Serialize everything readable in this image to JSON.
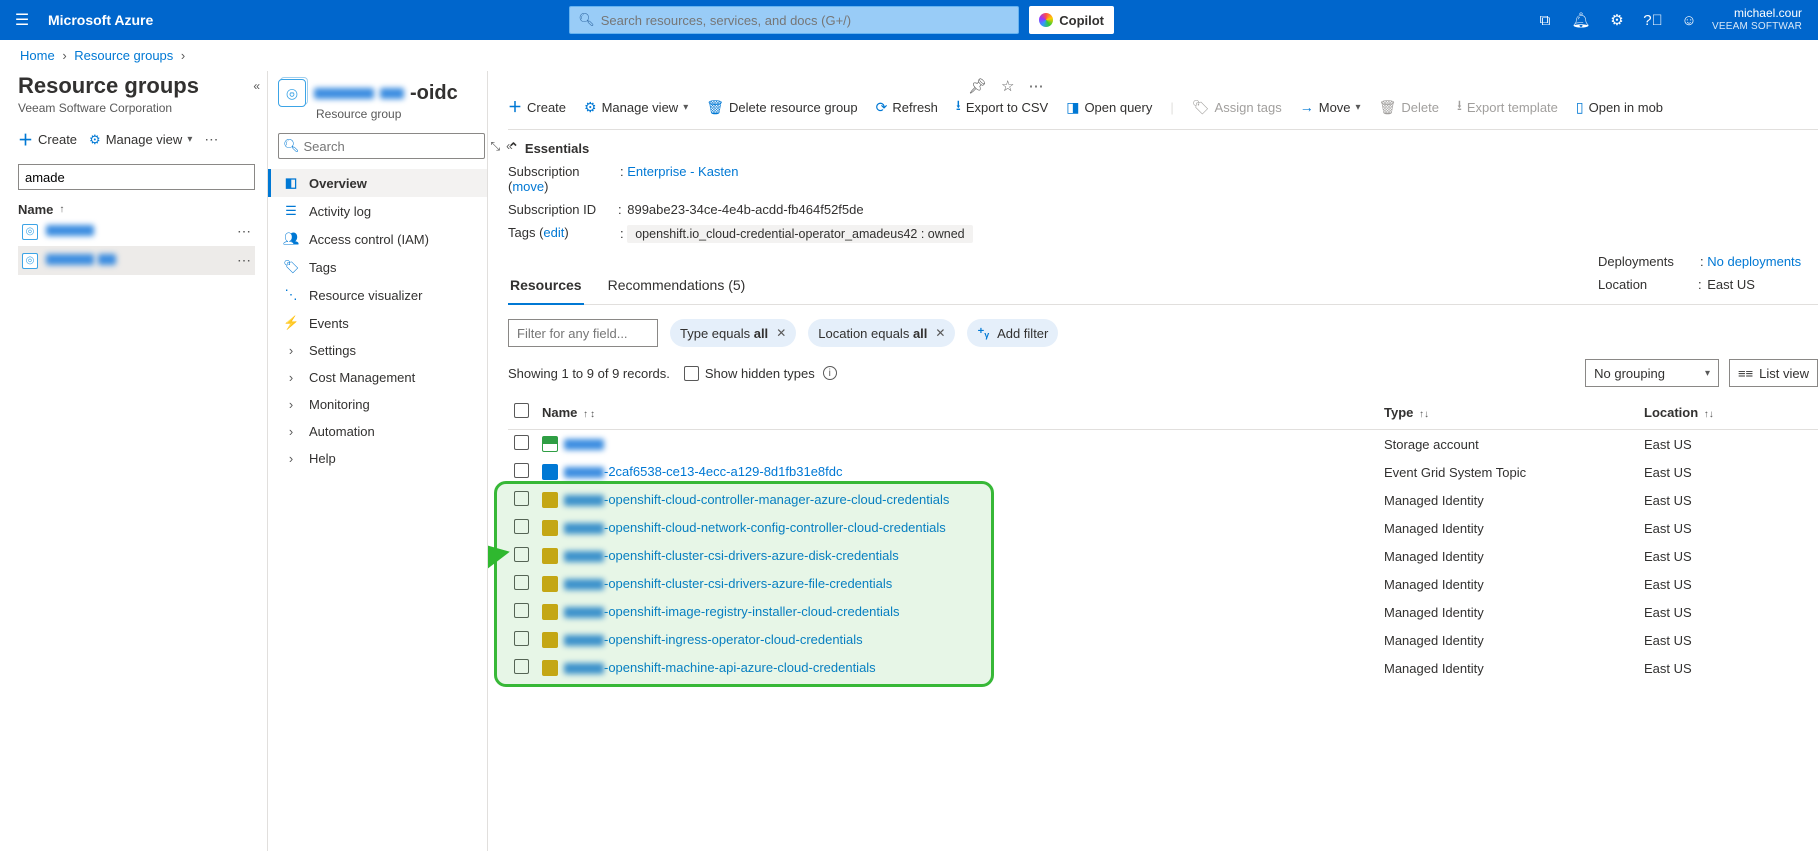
{
  "header": {
    "brand": "Microsoft Azure",
    "search_placeholder": "Search resources, services, and docs (G+/)",
    "copilot": "Copilot",
    "account_name": "michael.cour",
    "account_org": "VEEAM SOFTWAR"
  },
  "breadcrumb": {
    "home": "Home",
    "rg": "Resource groups"
  },
  "col1": {
    "title": "Resource groups",
    "subtitle": "Veeam Software Corporation",
    "create": "Create",
    "manage_view": "Manage view",
    "filter_value": "amade",
    "col_header": "Name",
    "items": [
      {
        "name": "████████"
      },
      {
        "name": "████████   ██"
      }
    ]
  },
  "rg_nav": {
    "title_suffix": "-oidc",
    "subtitle": "Resource group",
    "search_placeholder": "Search",
    "items": [
      {
        "icon": "overview",
        "label": "Overview",
        "active": true
      },
      {
        "icon": "activity",
        "label": "Activity log"
      },
      {
        "icon": "iam",
        "label": "Access control (IAM)"
      },
      {
        "icon": "tags",
        "label": "Tags"
      },
      {
        "icon": "visualizer",
        "label": "Resource visualizer"
      },
      {
        "icon": "events",
        "label": "Events"
      },
      {
        "icon": "chev",
        "label": "Settings"
      },
      {
        "icon": "chev",
        "label": "Cost Management"
      },
      {
        "icon": "chev",
        "label": "Monitoring"
      },
      {
        "icon": "chev",
        "label": "Automation"
      },
      {
        "icon": "chev",
        "label": "Help"
      }
    ]
  },
  "cmdbar": {
    "create": "Create",
    "manage_view": "Manage view",
    "delete_rg": "Delete resource group",
    "refresh": "Refresh",
    "export_csv": "Export to CSV",
    "open_query": "Open query",
    "assign_tags": "Assign tags",
    "move": "Move",
    "delete": "Delete",
    "export_template": "Export template",
    "open_mobile": "Open in mob"
  },
  "essentials": {
    "heading": "Essentials",
    "subscription_label": "Subscription",
    "subscription_move": "move",
    "subscription_value": "Enterprise - Kasten",
    "subscription_id_label": "Subscription ID",
    "subscription_id_value": "899abe23-34ce-4e4b-acdd-fb464f52f5de",
    "tags_label": "Tags",
    "tags_edit": "edit",
    "tag_chip": "openshift.io_cloud-credential-operator_amadeus42 : owned",
    "deployments_label": "Deployments",
    "deployments_value": "No deployments",
    "location_label": "Location",
    "location_value": "East US"
  },
  "tabs": {
    "resources": "Resources",
    "recommendations": "Recommendations (5)"
  },
  "filters": {
    "filter_placeholder": "Filter for any field...",
    "type_pill": "Type equals all",
    "location_pill": "Location equals all",
    "add_filter": "Add filter",
    "records": "Showing 1 to 9 of 9 records.",
    "hidden_types": "Show hidden types",
    "no_grouping": "No grouping",
    "list_view": "List view"
  },
  "table": {
    "col_name": "Name",
    "col_type": "Type",
    "col_location": "Location",
    "rows": [
      {
        "icon": "sa",
        "name_redacted": true,
        "suffix": "",
        "type": "Storage account",
        "location": "East US",
        "hl": false
      },
      {
        "icon": "eg",
        "name_redacted": true,
        "suffix": "-2caf6538-ce13-4ecc-a129-8d1fb31e8fdc",
        "type": "Event Grid System Topic",
        "location": "East US",
        "hl": false
      },
      {
        "icon": "mi",
        "name_redacted": true,
        "suffix": "-openshift-cloud-controller-manager-azure-cloud-credentials",
        "type": "Managed Identity",
        "location": "East US",
        "hl": true
      },
      {
        "icon": "mi",
        "name_redacted": true,
        "suffix": "-openshift-cloud-network-config-controller-cloud-credentials",
        "type": "Managed Identity",
        "location": "East US",
        "hl": true
      },
      {
        "icon": "mi",
        "name_redacted": true,
        "suffix": "-openshift-cluster-csi-drivers-azure-disk-credentials",
        "type": "Managed Identity",
        "location": "East US",
        "hl": true
      },
      {
        "icon": "mi",
        "name_redacted": true,
        "suffix": "-openshift-cluster-csi-drivers-azure-file-credentials",
        "type": "Managed Identity",
        "location": "East US",
        "hl": true
      },
      {
        "icon": "mi",
        "name_redacted": true,
        "suffix": "-openshift-image-registry-installer-cloud-credentials",
        "type": "Managed Identity",
        "location": "East US",
        "hl": true
      },
      {
        "icon": "mi",
        "name_redacted": true,
        "suffix": "-openshift-ingress-operator-cloud-credentials",
        "type": "Managed Identity",
        "location": "East US",
        "hl": true
      },
      {
        "icon": "mi",
        "name_redacted": true,
        "suffix": "-openshift-machine-api-azure-cloud-credentials",
        "type": "Managed Identity",
        "location": "East US",
        "hl": true
      }
    ]
  }
}
